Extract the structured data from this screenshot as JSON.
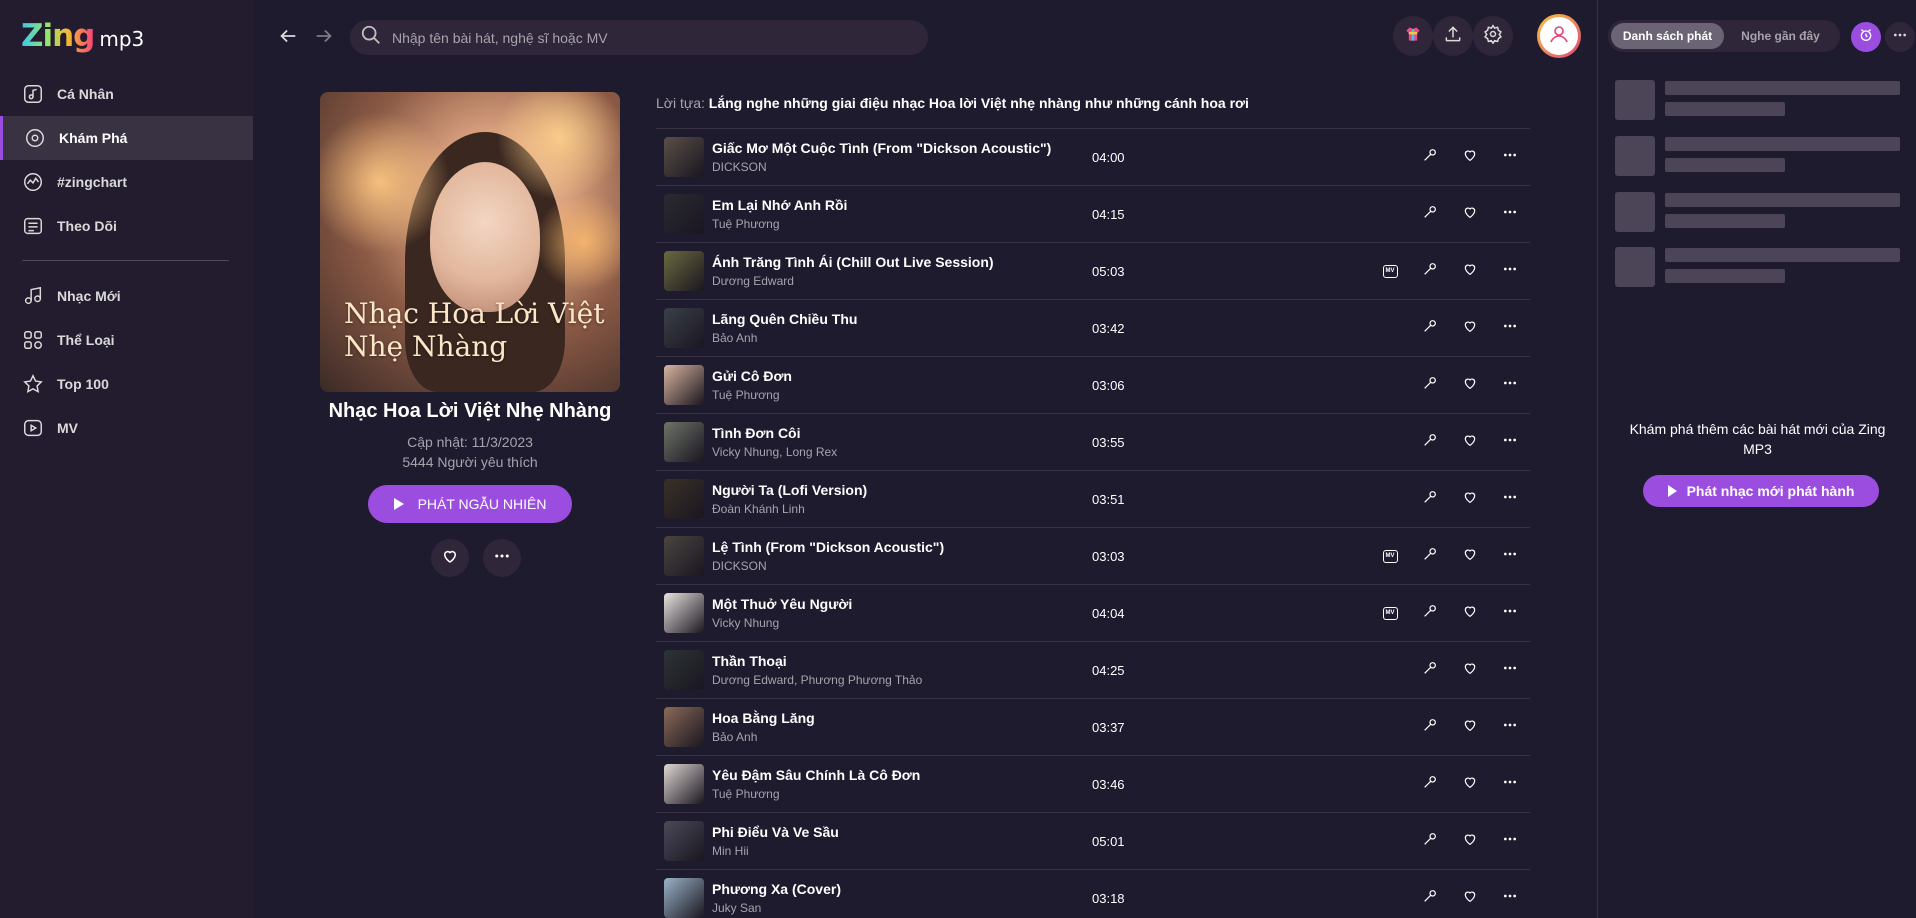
{
  "app": {
    "logo_zing": "Zing",
    "logo_mp3": "mp3"
  },
  "sidebar": {
    "items": [
      {
        "label": "Cá Nhân",
        "icon": "music-note-square-icon"
      },
      {
        "label": "Khám Phá",
        "icon": "disc-icon",
        "active": true
      },
      {
        "label": "#zingchart",
        "icon": "chart-wave-icon"
      },
      {
        "label": "Theo Dõi",
        "icon": "list-icon"
      }
    ],
    "items2": [
      {
        "label": "Nhạc Mới",
        "icon": "music-note-icon"
      },
      {
        "label": "Thể Loại",
        "icon": "category-icon"
      },
      {
        "label": "Top 100",
        "icon": "star-icon"
      },
      {
        "label": "MV",
        "icon": "video-icon"
      }
    ]
  },
  "header": {
    "search_placeholder": "Nhập tên bài hát, nghệ sĩ hoặc MV"
  },
  "album": {
    "cover_text": "Nhạc Hoa Lời Việt Nhẹ Nhàng",
    "title": "Nhạc Hoa Lời Việt Nhẹ Nhàng",
    "updated": "Cập nhật: 11/3/2023",
    "likes": "5444 Người yêu thích",
    "shuffle_label": "PHÁT NGẪU NHIÊN"
  },
  "preface": {
    "label": "Lời tựa:",
    "text": "Lắng nghe những giai điệu nhạc Hoa lời Việt nhẹ nhàng như những cánh hoa rơi"
  },
  "songs": [
    {
      "title": "Giấc Mơ Một Cuộc Tình (From \"Dickson Acoustic\")",
      "artist": "DICKSON",
      "duration": "04:00",
      "mv": false,
      "color": "#5a5048"
    },
    {
      "title": "Em Lại Nhớ Anh Rồi",
      "artist": "Tuệ Phương",
      "duration": "04:15",
      "mv": false,
      "color": "#2a2a30"
    },
    {
      "title": "Ánh Trăng Tình Ái (Chill Out Live Session)",
      "artist": "Dương Edward",
      "duration": "05:03",
      "mv": true,
      "color": "#6b6a40"
    },
    {
      "title": "Lãng Quên Chiều Thu",
      "artist": "Bảo Anh",
      "duration": "03:42",
      "mv": false,
      "color": "#3a4048"
    },
    {
      "title": "Gửi Cô Đơn",
      "artist": "Tuệ Phương",
      "duration": "03:06",
      "mv": false,
      "color": "#d9b5a0"
    },
    {
      "title": "Tình Đơn Côi",
      "artist": "Vicky Nhung, Long Rex",
      "duration": "03:55",
      "mv": false,
      "color": "#6d7468"
    },
    {
      "title": "Người Ta (Lofi Version)",
      "artist": "Đoàn Khánh Linh",
      "duration": "03:51",
      "mv": false,
      "color": "#3a3028"
    },
    {
      "title": "Lệ Tình (From \"Dickson Acoustic\")",
      "artist": "DICKSON",
      "duration": "03:03",
      "mv": true,
      "color": "#4a4540"
    },
    {
      "title": "Một Thuở Yêu Người",
      "artist": "Vicky Nhung",
      "duration": "04:04",
      "mv": true,
      "color": "#e8e4e0"
    },
    {
      "title": "Thần Thoại",
      "artist": "Dương Edward, Phương Phương Thảo",
      "duration": "04:25",
      "mv": false,
      "color": "#2c3436"
    },
    {
      "title": "Hoa Bằng Lăng",
      "artist": "Bảo Anh",
      "duration": "03:37",
      "mv": false,
      "color": "#8a6a58"
    },
    {
      "title": "Yêu Đậm Sâu Chính Là Cô Đơn",
      "artist": "Tuệ Phương",
      "duration": "03:46",
      "mv": false,
      "color": "#e0d8d4"
    },
    {
      "title": "Phi Điểu Và Ve Sầu",
      "artist": "Min Hii",
      "duration": "05:01",
      "mv": false,
      "color": "#4a4a58"
    },
    {
      "title": "Phương Xa (Cover)",
      "artist": "Juky San",
      "duration": "03:18",
      "mv": false,
      "color": "#9ab4c8"
    }
  ],
  "right_panel": {
    "tab_playlist": "Danh sách phát",
    "tab_recent": "Nghe gần đây",
    "message": "Khám phá thêm các bài hát mới của Zing MP3",
    "cta": "Phát nhạc mới phát hành"
  },
  "colors": {
    "accent": "#9b4de0",
    "background": "#1e1b2e",
    "sidebar": "#231b2e"
  }
}
